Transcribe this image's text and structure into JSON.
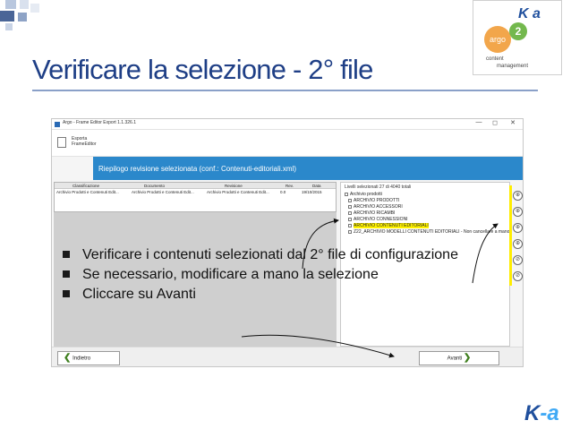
{
  "slide": {
    "title": "Verificare la selezione - 2° file",
    "logo": {
      "text": "K a",
      "argo": "argo",
      "two": "2",
      "cm_line1": "content",
      "cm_line2": "management"
    },
    "footer_logo": {
      "k": "K",
      "a": "-a"
    }
  },
  "window": {
    "title": "Argo - Frame Editor Export 1.1.326.1",
    "controls": [
      "—",
      "◻",
      "✕"
    ],
    "toolbar_label": "Esporta\nFrameEditor",
    "section_header": "Riepilogo revisione selezionata (conf.: Contenuti-editoriali.xml)",
    "table": {
      "columns": [
        "Classificazione",
        "Documento",
        "Revisione",
        "Rev.",
        "Data"
      ],
      "rows": [
        [
          "Archivio Prodotti e Contenuti Edit...",
          "Archivio Prodotti e Contenuti Edit...",
          "Archivio Prodotti e Contenuti Edit...",
          "0.0",
          "19/10/2015"
        ]
      ]
    },
    "tree": {
      "caption": "Livelli selezionati 27 di 4040 totali",
      "items": [
        "Archivio prodotti",
        "ARCHIVIO PRODOTTI",
        "ARCHIVIO ACCESSORI",
        "ARCHIVIO RICAMBI",
        "ARCHIVIO CONNESSIONI",
        "ARCHIVIO CONTENUTI EDITORIALI",
        "Z22_ARCHIVIO MODELLI CONTENUTI EDITORIALI - Non cancellare a mano"
      ],
      "highlighted_index": 5
    },
    "side_buttons": [
      "⊕",
      "⊕",
      "⊕",
      "⊕",
      "⊘",
      "⊘"
    ],
    "buttons": {
      "back": "Indietro",
      "next": "Avanti"
    }
  },
  "bullets": [
    "Verificare i contenuti selezionati dal 2° file di configurazione",
    "Se necessario, modificare a mano la selezione",
    "Cliccare su Avanti"
  ],
  "colors": {
    "title": "#1f3f86",
    "header_blue": "#2b88cb",
    "highlight": "#fff200"
  }
}
